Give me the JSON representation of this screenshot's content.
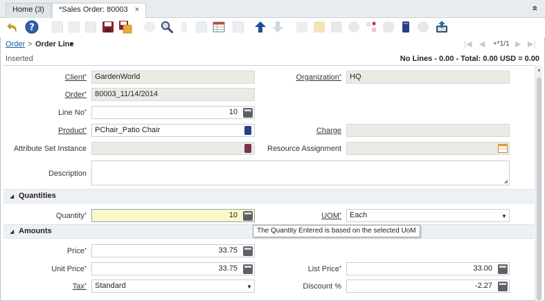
{
  "tabs": [
    {
      "label": "Home (3)"
    },
    {
      "label": "*Sales Order: 80003",
      "close": "×"
    }
  ],
  "collapse": "»",
  "breadcrumb": {
    "parent": "Order",
    "sep": ">",
    "current": "Order Line",
    "caret": "▾"
  },
  "record_nav": {
    "count": "+*1/1",
    "first": "|◀",
    "prev": "◀",
    "next": "▶",
    "last": "▶|"
  },
  "status": {
    "left": "Inserted",
    "right": "No Lines - 0.00 - Total: 0.00 USD = 0.00"
  },
  "req_mark": "*",
  "fields": {
    "client": {
      "label": "Client",
      "value": "GardenWorld"
    },
    "organization": {
      "label": "Organization",
      "value": "HQ"
    },
    "order": {
      "label": "Order",
      "value": "80003_11/14/2014"
    },
    "line_no": {
      "label": "Line No",
      "value": "10"
    },
    "product": {
      "label": "Product",
      "value": "PChair_Patio Chair"
    },
    "charge": {
      "label": "Charge",
      "value": ""
    },
    "attr_set": {
      "label": "Attribute Set Instance",
      "value": ""
    },
    "resource": {
      "label": "Resource Assignment",
      "value": ""
    },
    "description": {
      "label": "Description",
      "value": ""
    },
    "quantity": {
      "label": "Quantity",
      "value": "10"
    },
    "uom": {
      "label": "UOM",
      "value": "Each"
    },
    "price": {
      "label": "Price",
      "value": "33.75"
    },
    "unit_price": {
      "label": "Unit Price",
      "value": "33.75"
    },
    "list_price": {
      "label": "List Price",
      "value": "33.00"
    },
    "tax": {
      "label": "Tax",
      "value": "Standard"
    },
    "discount": {
      "label": "Discount %",
      "value": "-2.27"
    }
  },
  "sections": {
    "quantities": "Quantities",
    "amounts": "Amounts"
  },
  "tooltip": "The Quantity Entered is based on the selected UoM",
  "icons": {
    "undo": "undo-icon",
    "help": "help-icon",
    "save": "save-icon",
    "find": "search-icon",
    "up": "arrow-up-icon",
    "down": "arrow-down-icon",
    "export": "export-icon"
  },
  "colors": {
    "accent": "#1f6fb2",
    "readonly_bg": "#ebebe6",
    "focus_bg": "#fbf8c8",
    "link": "#1c5aa0"
  }
}
